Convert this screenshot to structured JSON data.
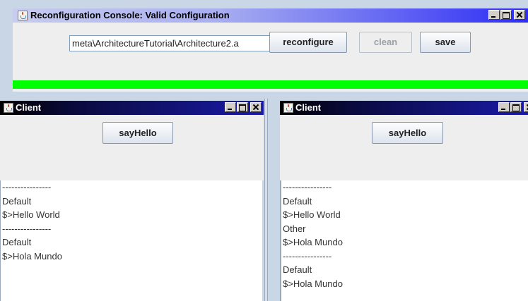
{
  "console": {
    "title": "Reconfiguration Console: Valid Configuration",
    "path_value": "meta\\ArchitectureTutorial\\Architecture2.a",
    "buttons": {
      "reconfigure": "reconfigure",
      "clean": "clean",
      "save": "save"
    },
    "status_color": "#00ff00"
  },
  "clients": [
    {
      "title": "Client",
      "button": "sayHello",
      "output": [
        "----------------",
        "Default",
        "$>Hello World",
        "----------------",
        "Default",
        "$>Hola Mundo"
      ]
    },
    {
      "title": "Client",
      "button": "sayHello",
      "output": [
        "----------------",
        "Default",
        "$>Hello World",
        "Other",
        "$>Hola Mundo",
        "----------------",
        "Default",
        "$>Hola Mundo"
      ]
    }
  ],
  "icons": [
    "java-icon",
    "minimize-icon",
    "maximize-icon",
    "close-icon"
  ]
}
